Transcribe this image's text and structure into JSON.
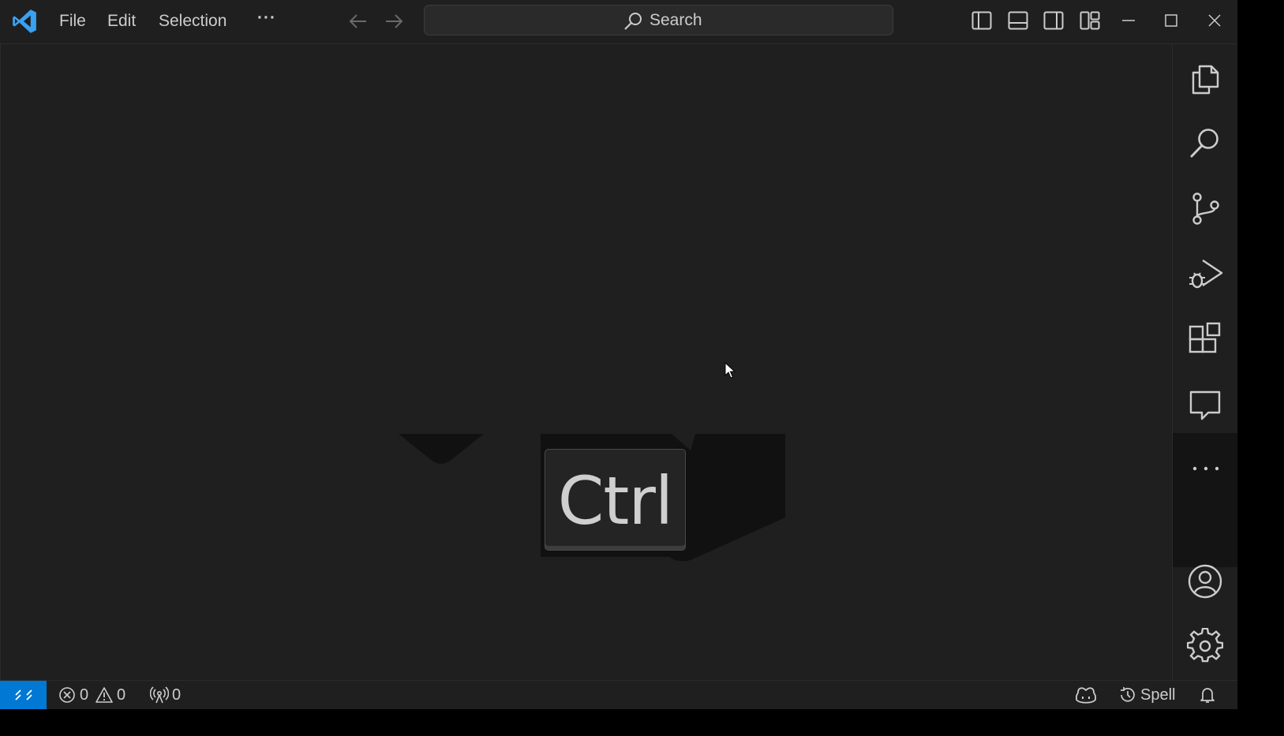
{
  "menu": {
    "file": "File",
    "edit": "Edit",
    "selection": "Selection",
    "more": "···"
  },
  "search": {
    "label": "Search"
  },
  "titlebar_icons": [
    "back-arrow-icon",
    "forward-arrow-icon",
    "toggle-primary-sidebar-icon",
    "toggle-panel-icon",
    "toggle-secondary-sidebar-icon",
    "customize-layout-icon",
    "minimize-icon",
    "maximize-icon",
    "close-icon"
  ],
  "activity_bar": [
    "explorer-icon",
    "search-icon",
    "source-control-icon",
    "run-debug-icon",
    "extensions-icon",
    "chat-icon",
    "more-icon",
    "accounts-icon",
    "manage-gear-icon"
  ],
  "overlay": {
    "key": "Ctrl"
  },
  "status": {
    "errors": "0",
    "warnings": "0",
    "ports": "0",
    "spell": "Spell"
  },
  "colors": {
    "accent": "#0078d4",
    "vscode_logo": "#3aa0f0",
    "background": "#1f1f1f"
  }
}
